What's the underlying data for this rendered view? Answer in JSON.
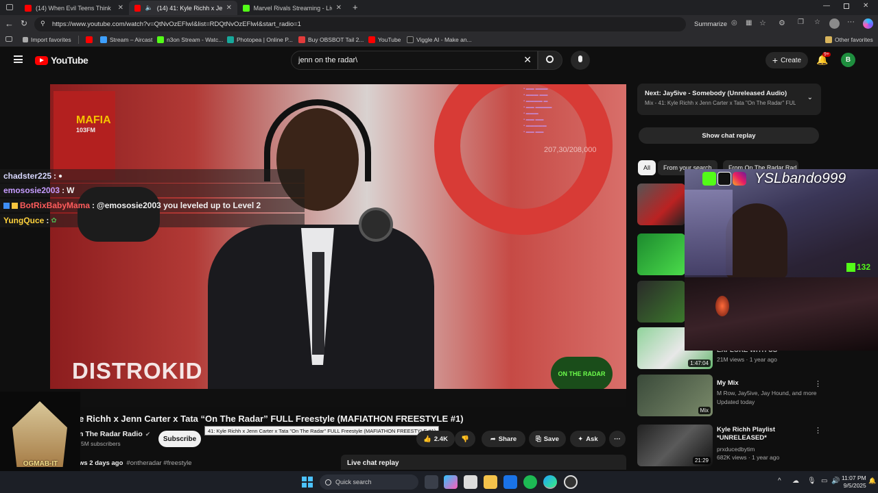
{
  "browser": {
    "tabs": [
      {
        "label": "(14) When Evil Teens Think Murde",
        "active": false
      },
      {
        "label": "(14) 41: Kyle Richh x Jenn Ca",
        "active": true
      },
      {
        "label": "Marvel Rivals Streaming - Live St",
        "active": false
      }
    ],
    "url": "https://www.youtube.com/watch?v=QtNvOzEFlwI&list=RDQtNvOzEFlwI&start_radio=1",
    "summarize_label": "Summarize",
    "bookmarks": [
      "Import favorites",
      "Stream – Aircast",
      "n3on Stream - Watc...",
      "Photopea | Online P...",
      "Buy OBSBOT Tail 2...",
      "YouTube",
      "Viggle AI - Make an..."
    ],
    "other_favorites": "Other favorites"
  },
  "youtube": {
    "logo_text": "YouTube",
    "search_value": "jenn on the radar\\",
    "create_label": "Create",
    "notif_count": "9+",
    "avatar_letter": "B"
  },
  "video": {
    "watermark": "DISTROKID",
    "brand_logo": "ON THE RADAR",
    "station_left": "MAFIA",
    "station_sub": "103FM",
    "chat_count": "207,30/208,000",
    "title": "e Richh x Jenn Carter x Tata “On The Radar” FULL Freestyle (MAFIATHON FREESTYLE #1)",
    "tooltip": "41: Kyle Richh x Jenn Carter x Tata \"On The Radar\" FULL Freestyle (MAFIATHON FREESTYLE #1)",
    "channel": "n The Radar Radio",
    "subscribers": "5M subscribers",
    "subscribe_label": "Subscribe",
    "likes": "2.4K",
    "share_label": "Share",
    "save_label": "Save",
    "ask_label": "Ask",
    "views_line": "ws  2 days ago",
    "tags": "#ontheradar #freestyle",
    "live_chat_replay": "Live chat replay"
  },
  "chat_overlay": [
    {
      "user": "chadster225",
      "msg": "",
      "color": "#d8d8ff"
    },
    {
      "user": "emososie2003",
      "msg": "W",
      "color": "#c69cff"
    },
    {
      "user": "BotRixBabyMama",
      "msg": "@emososie2003 you leveled up to Level 2",
      "color": "#ff5c5c"
    },
    {
      "user": "YungQuce",
      "msg": "",
      "color": "#ffd23c"
    }
  ],
  "sidebar": {
    "next_label": "Next: Jay5ive - Somebody (Unreleased Audio)",
    "next_sub": "Mix - 41: Kyle Richh x Jenn Carter x Tata \"On The Radar\" FUL...",
    "show_chat_replay": "Show chat replay",
    "chips": [
      "All",
      "From your search",
      "From On The Radar Rad"
    ],
    "recs": [
      {
        "duration": "1:47:04",
        "title": "EXPLORE WITH US",
        "meta1": "21M views · 1 year ago",
        "meta2": ""
      },
      {
        "duration": "",
        "title": "My Mix",
        "meta1": "M Row, Jay5ive, Jay Hound, and more",
        "meta2": "Updated today",
        "badge": "Mix"
      },
      {
        "duration": "21:29",
        "title": "Kyle Richh Playlist *UNRELEASED*",
        "meta1": "prxducedbytim",
        "meta2": "682K views · 1 year ago"
      }
    ]
  },
  "webcam": {
    "handle": "YSLbando999",
    "count": "132"
  },
  "overlay_logo": "OGMAB-IT",
  "taskbar": {
    "search_placeholder": "Quick search",
    "time": "11:07 PM",
    "date": "9/5/2025"
  },
  "colors": {
    "youtube_red": "#ff0000",
    "accent_green": "#1db954"
  }
}
